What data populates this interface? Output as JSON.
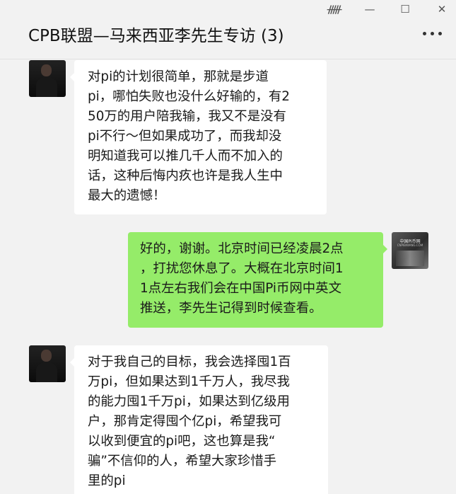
{
  "window": {
    "pin_icon": "📌",
    "minimize_icon": "minimize-icon",
    "maximize_icon": "maximize-icon",
    "close_icon": "close-icon",
    "pin_glyph": "ᚏ",
    "minimize_glyph": "—",
    "maximize_glyph": "☐",
    "close_glyph": "✕"
  },
  "header": {
    "title": "CPB联盟—马来西亚李先生专访 (3)",
    "more_icon": "more-icon"
  },
  "colors": {
    "background": "#f2f2f2",
    "incoming_bubble": "#ffffff",
    "outgoing_bubble": "#95ec69"
  },
  "avatars": {
    "right_brand": "中国Pi币网",
    "right_sub": "CNPIBIWANG.COM"
  },
  "messages": [
    {
      "side": "incoming",
      "lines": [
        "对pi的计划很简单，那就是步道",
        "pi，哪怕失败也没什么好输的，有2",
        "50万的用户陪我输，我又不是没有",
        "pi不行～但如果成功了，而我却没",
        "明知道我可以推几千人而不加入的",
        "话，这种后悔内疚也许是我人生中",
        "最大的遗憾！"
      ]
    },
    {
      "side": "outgoing",
      "lines": [
        "好的，谢谢。北京时间已经凌晨2点",
        "，打扰您休息了。大概在北京时间1",
        "1点左右我们会在中国Pi币网中英文",
        "推送，李先生记得到时候查看。"
      ]
    },
    {
      "side": "incoming",
      "lines": [
        "对于我自己的目标，我会选择囤1百",
        "万pi，但如果达到1千万人，我尽我",
        "的能力囤1千万pi，如果达到亿级用",
        "户，那肯定得囤个亿pi，希望我可",
        "以收到便宜的pi吧，这也算是我“",
        "骗”不信仰的人，希望大家珍惜手",
        "里的pi"
      ]
    }
  ]
}
